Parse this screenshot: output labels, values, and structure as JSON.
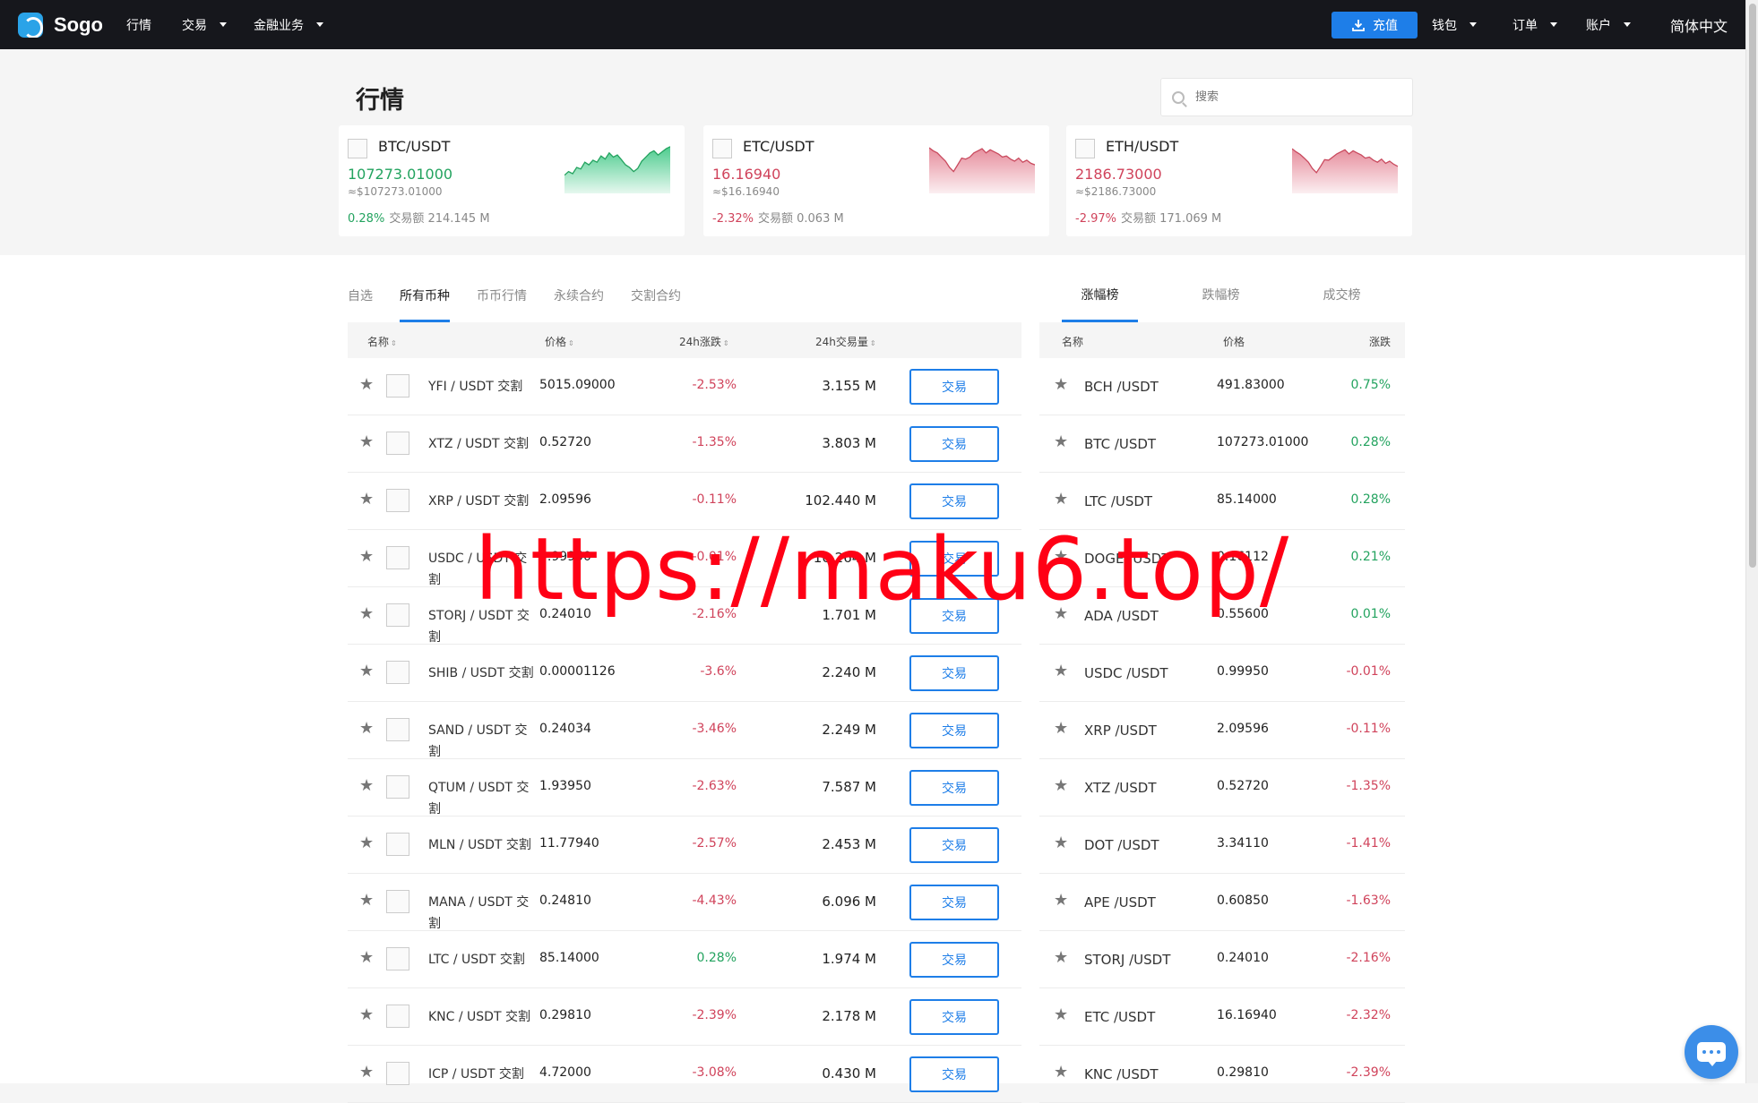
{
  "header": {
    "brand": "Sogo",
    "nav": [
      {
        "label": "行情",
        "dropdown": false
      },
      {
        "label": "交易",
        "dropdown": true
      },
      {
        "label": "金融业务",
        "dropdown": true
      }
    ],
    "recharge_label": "充值",
    "wallet_label": "钱包",
    "orders_label": "订单",
    "account_label": "账户",
    "language_label": "简体中文"
  },
  "page": {
    "title": "行情",
    "search_placeholder": "搜索"
  },
  "cards": [
    {
      "pair": "BTC/USDT",
      "price": "107273.01000",
      "approx": "≈$107273.01000",
      "change": "0.28%",
      "volume_label": "交易额 214.145 M",
      "trend": "up",
      "sparkline": [
        0.35,
        0.42,
        0.38,
        0.5,
        0.47,
        0.6,
        0.55,
        0.64,
        0.6,
        0.72,
        0.66,
        0.78,
        0.7,
        0.74,
        0.65,
        0.55,
        0.5,
        0.42,
        0.48,
        0.62,
        0.7,
        0.78,
        0.82,
        0.74,
        0.8,
        0.86,
        0.9
      ]
    },
    {
      "pair": "ETC/USDT",
      "price": "16.16940",
      "approx": "≈$16.16940",
      "change": "-2.32%",
      "volume_label": "交易额 0.063 M",
      "trend": "down",
      "sparkline": [
        0.88,
        0.82,
        0.78,
        0.7,
        0.62,
        0.5,
        0.42,
        0.55,
        0.68,
        0.66,
        0.7,
        0.78,
        0.82,
        0.86,
        0.78,
        0.84,
        0.8,
        0.76,
        0.7,
        0.72,
        0.66,
        0.62,
        0.68,
        0.6,
        0.64,
        0.58,
        0.55
      ]
    },
    {
      "pair": "ETH/USDT",
      "price": "2186.73000",
      "approx": "≈$2186.73000",
      "change": "-2.97%",
      "volume_label": "交易额 171.069 M",
      "trend": "down",
      "sparkline": [
        0.86,
        0.8,
        0.75,
        0.68,
        0.6,
        0.48,
        0.4,
        0.52,
        0.65,
        0.64,
        0.7,
        0.76,
        0.8,
        0.84,
        0.76,
        0.82,
        0.78,
        0.74,
        0.68,
        0.7,
        0.64,
        0.6,
        0.66,
        0.58,
        0.62,
        0.56,
        0.52
      ]
    }
  ],
  "market_tabs": [
    "自选",
    "所有币种",
    "币币行情",
    "永续合约",
    "交割合约"
  ],
  "market_active_tab": 1,
  "market_headers": {
    "name": "名称",
    "price": "价格",
    "change": "24h涨跌",
    "volume": "24h交易量"
  },
  "trade_label": "交易",
  "market_rows": [
    {
      "name": "YFI / USDT 交割",
      "price": "5015.09000",
      "change": "-2.53%",
      "dir": "down",
      "volume": "3.155 M"
    },
    {
      "name": "XTZ / USDT 交割",
      "price": "0.52720",
      "change": "-1.35%",
      "dir": "down",
      "volume": "3.803 M"
    },
    {
      "name": "XRP / USDT 交割",
      "price": "2.09596",
      "change": "-0.11%",
      "dir": "down",
      "volume": "102.440 M"
    },
    {
      "name": "USDC / USDT 交割",
      "price": "0.99950",
      "change": "-0.01%",
      "dir": "down",
      "volume": "10.264 M"
    },
    {
      "name": "STORJ / USDT 交割",
      "price": "0.24010",
      "change": "-2.16%",
      "dir": "down",
      "volume": "1.701 M"
    },
    {
      "name": "SHIB / USDT 交割",
      "price": "0.00001126",
      "change": "-3.6%",
      "dir": "down",
      "volume": "2.240 M"
    },
    {
      "name": "SAND / USDT 交割",
      "price": "0.24034",
      "change": "-3.46%",
      "dir": "down",
      "volume": "2.249 M"
    },
    {
      "name": "QTUM / USDT 交割",
      "price": "1.93950",
      "change": "-2.63%",
      "dir": "down",
      "volume": "7.587 M"
    },
    {
      "name": "MLN / USDT 交割",
      "price": "11.77940",
      "change": "-2.57%",
      "dir": "down",
      "volume": "2.453 M"
    },
    {
      "name": "MANA / USDT 交割",
      "price": "0.24810",
      "change": "-4.43%",
      "dir": "down",
      "volume": "6.096 M"
    },
    {
      "name": "LTC / USDT 交割",
      "price": "85.14000",
      "change": "0.28%",
      "dir": "up",
      "volume": "1.974 M"
    },
    {
      "name": "KNC / USDT 交割",
      "price": "0.29810",
      "change": "-2.39%",
      "dir": "down",
      "volume": "2.178 M"
    },
    {
      "name": "ICP / USDT 交割",
      "price": "4.72000",
      "change": "-3.08%",
      "dir": "down",
      "volume": "0.430 M"
    }
  ],
  "rank_tabs": [
    "涨幅榜",
    "跌幅榜",
    "成交榜"
  ],
  "rank_active_tab": 0,
  "rank_headers": {
    "name": "名称",
    "price": "价格",
    "change": "涨跌"
  },
  "rank_rows": [
    {
      "name": "BCH /USDT",
      "price": "491.83000",
      "change": "0.75%",
      "dir": "up"
    },
    {
      "name": "BTC /USDT",
      "price": "107273.01000",
      "change": "0.28%",
      "dir": "up"
    },
    {
      "name": "LTC /USDT",
      "price": "85.14000",
      "change": "0.28%",
      "dir": "up"
    },
    {
      "name": "DOGE /USDT",
      "price": "0.16112",
      "change": "0.21%",
      "dir": "up"
    },
    {
      "name": "ADA /USDT",
      "price": "0.55600",
      "change": "0.01%",
      "dir": "up"
    },
    {
      "name": "USDC /USDT",
      "price": "0.99950",
      "change": "-0.01%",
      "dir": "down"
    },
    {
      "name": "XRP /USDT",
      "price": "2.09596",
      "change": "-0.11%",
      "dir": "down"
    },
    {
      "name": "XTZ /USDT",
      "price": "0.52720",
      "change": "-1.35%",
      "dir": "down"
    },
    {
      "name": "DOT /USDT",
      "price": "3.34110",
      "change": "-1.41%",
      "dir": "down"
    },
    {
      "name": "APE /USDT",
      "price": "0.60850",
      "change": "-1.63%",
      "dir": "down"
    },
    {
      "name": "STORJ /USDT",
      "price": "0.24010",
      "change": "-2.16%",
      "dir": "down"
    },
    {
      "name": "ETC /USDT",
      "price": "16.16940",
      "change": "-2.32%",
      "dir": "down"
    },
    {
      "name": "KNC /USDT",
      "price": "0.29810",
      "change": "-2.39%",
      "dir": "down"
    }
  ],
  "watermark": "https://maku6.top/",
  "colors": {
    "up": "#23a35f",
    "down": "#d0435b",
    "accent": "#1e7ee8",
    "topbar": "#16171c"
  }
}
